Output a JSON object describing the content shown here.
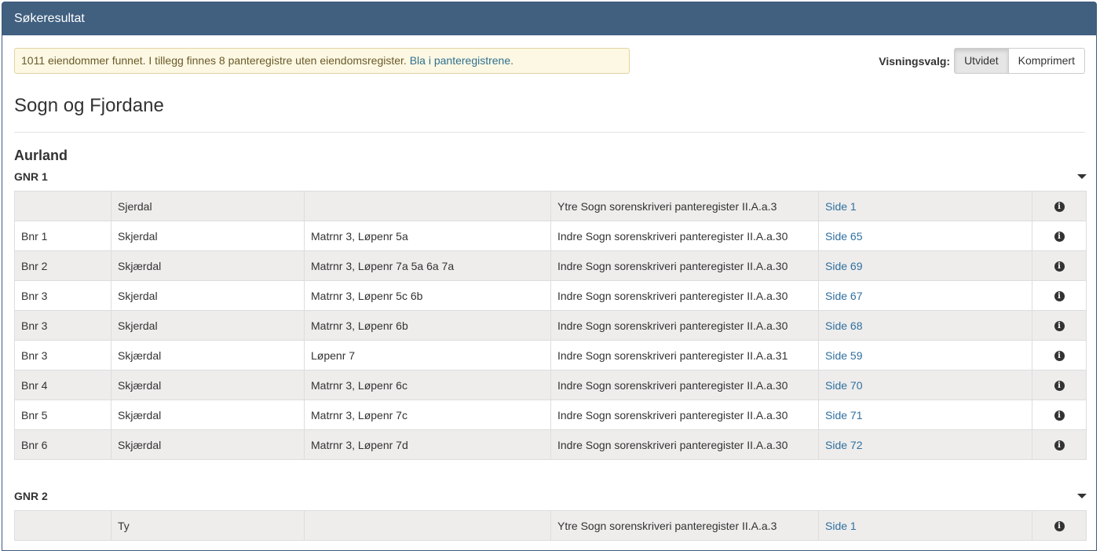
{
  "panel": {
    "title": "Søkeresultat"
  },
  "alert": {
    "text": "1011 eiendommer funnet. I tillegg finnes 8 panteregistre uten eiendomsregister.",
    "link": "Bla i panteregistrene."
  },
  "view_options": {
    "label": "Visningsvalg:",
    "options": [
      "Utvidet",
      "Komprimert"
    ],
    "selected": "Utvidet"
  },
  "region": "Sogn og Fjordane",
  "municipality": "Aurland",
  "groups": [
    {
      "label": "GNR 1",
      "rows": [
        {
          "bnr": "",
          "name": "Sjerdal",
          "matr": "",
          "register": "Ytre Sogn sorenskriveri panteregister II.A.a.3",
          "side": "Side 1"
        },
        {
          "bnr": "Bnr 1",
          "name": "Skjerdal",
          "matr": "Matrnr 3, Løpenr 5a",
          "register": "Indre Sogn sorenskriveri panteregister II.A.a.30",
          "side": "Side 65"
        },
        {
          "bnr": "Bnr 2",
          "name": "Skjærdal",
          "matr": "Matrnr 3, Løpenr 7a 5a 6a 7a",
          "register": "Indre Sogn sorenskriveri panteregister II.A.a.30",
          "side": "Side 69"
        },
        {
          "bnr": "Bnr 3",
          "name": "Skjerdal",
          "matr": "Matrnr 3, Løpenr 5c 6b",
          "register": "Indre Sogn sorenskriveri panteregister II.A.a.30",
          "side": "Side 67"
        },
        {
          "bnr": "Bnr 3",
          "name": "Skjerdal",
          "matr": "Matrnr 3, Løpenr 6b",
          "register": "Indre Sogn sorenskriveri panteregister II.A.a.30",
          "side": "Side 68"
        },
        {
          "bnr": "Bnr 3",
          "name": "Skjærdal",
          "matr": "Løpenr 7",
          "register": "Indre Sogn sorenskriveri panteregister II.A.a.31",
          "side": "Side 59"
        },
        {
          "bnr": "Bnr 4",
          "name": "Skjærdal",
          "matr": "Matrnr 3, Løpenr 6c",
          "register": "Indre Sogn sorenskriveri panteregister II.A.a.30",
          "side": "Side 70"
        },
        {
          "bnr": "Bnr 5",
          "name": "Skjærdal",
          "matr": "Matrnr 3, Løpenr 7c",
          "register": "Indre Sogn sorenskriveri panteregister II.A.a.30",
          "side": "Side 71"
        },
        {
          "bnr": "Bnr 6",
          "name": "Skjærdal",
          "matr": "Matrnr 3, Løpenr 7d",
          "register": "Indre Sogn sorenskriveri panteregister II.A.a.30",
          "side": "Side 72"
        }
      ]
    },
    {
      "label": "GNR 2",
      "rows": [
        {
          "bnr": "",
          "name": "Ty",
          "matr": "",
          "register": "Ytre Sogn sorenskriveri panteregister II.A.a.3",
          "side": "Side 1"
        }
      ]
    }
  ],
  "icons": {
    "info": "info-icon",
    "toggle": "caret-down-icon"
  }
}
